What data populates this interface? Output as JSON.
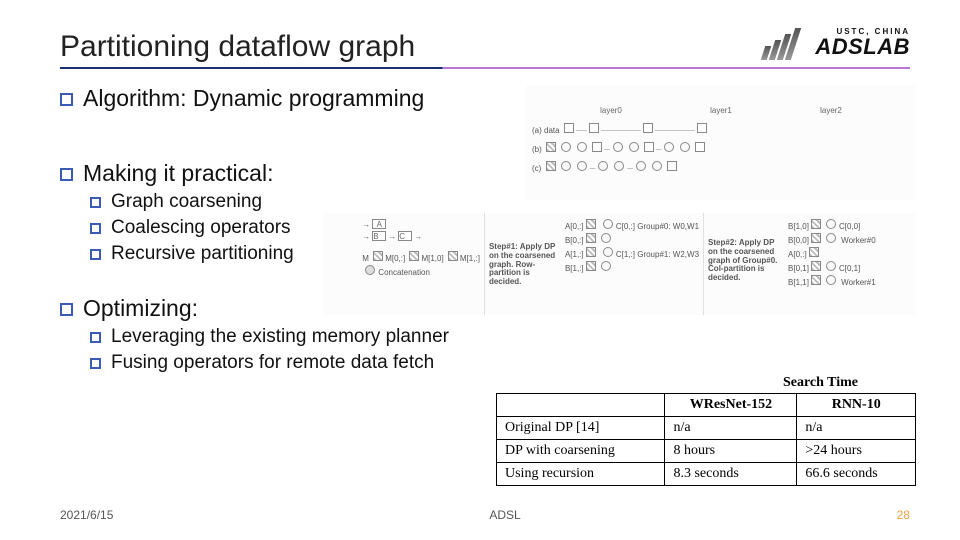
{
  "header": {
    "title": "Partitioning dataflow graph",
    "logo_sub": "USTC, CHINA",
    "logo_main": "ADSLAB"
  },
  "bullets": {
    "b1": "Algorithm: Dynamic programming",
    "b2": "Making it practical:",
    "b2_sub": [
      "Graph coarsening",
      "Coalescing operators",
      "Recursive partitioning"
    ],
    "b3": "Optimizing:",
    "b3_sub": [
      "Leveraging the existing memory planner",
      "Fusing operators for remote data fetch"
    ]
  },
  "fig_top": {
    "layers": [
      "layer0",
      "layer1",
      "layer2"
    ],
    "rows": [
      "(a) data",
      "(b)",
      "(c)"
    ]
  },
  "fig_mid": {
    "panel1_labels": [
      "A",
      "B",
      "C",
      "M[0,:]",
      "M[1,0]",
      "M[1,:]",
      "Concatenation"
    ],
    "panel2_title": "Step#1: Apply DP on the coarsened graph. Row-partition is decided.",
    "panel2_labels": [
      "A[0,:]",
      "B[0,:]",
      "A[1,:]",
      "B[1,:]",
      "C",
      "C",
      "C[0,:]",
      "C[1,:]",
      "Group#0: W0,W1",
      "Group#1: W2,W3"
    ],
    "panel3_title": "Step#2: Apply DP on the coarsened graph of Group#0. Col-partition is decided.",
    "panel3_labels": [
      "B[1,0]",
      "B[0,0]",
      "A[0,:]",
      "B[0,1]",
      "B[1,1]",
      "C",
      "C",
      "C",
      "C[0,0]",
      "C[0,1]",
      "Worker#0",
      "Worker#1"
    ]
  },
  "table": {
    "caption": "Search Time",
    "headers": [
      "",
      "WResNet-152",
      "RNN-10"
    ],
    "rows": [
      [
        "Original DP [14]",
        "n/a",
        "n/a"
      ],
      [
        "DP with coarsening",
        "8 hours",
        ">24 hours"
      ],
      [
        "Using recursion",
        "8.3 seconds",
        "66.6 seconds"
      ]
    ]
  },
  "footer": {
    "date": "2021/6/15",
    "center": "ADSL",
    "page": "28"
  }
}
